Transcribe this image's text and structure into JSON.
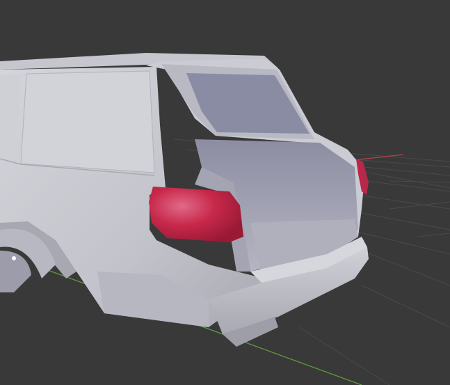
{
  "viewport": {
    "background_color": "#393939",
    "grid_color": "#4a4a4a",
    "x_axis_color": "#a0434a",
    "y_axis_color": "#5c9c3c",
    "model_color": "#c9c9d1",
    "taillight_color": "#c8284a",
    "cursor_icon": "cursor-dot-icon"
  }
}
